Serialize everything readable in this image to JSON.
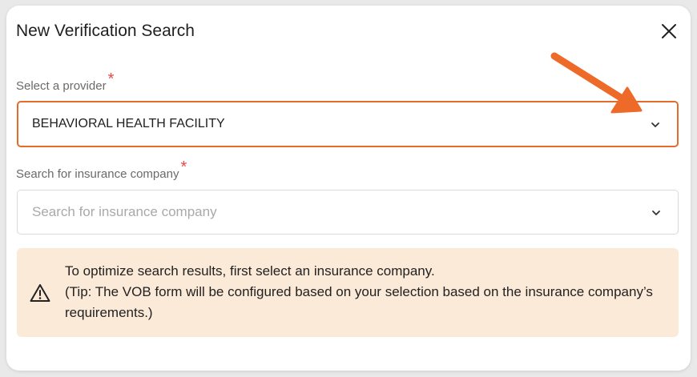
{
  "dialog": {
    "title": "New Verification Search",
    "close_icon": "close-icon"
  },
  "provider": {
    "label": "Select a provider",
    "required_marker": "*",
    "value": "BEHAVIORAL HEALTH FACILITY",
    "state": "focused",
    "icon": "chevron-down-icon"
  },
  "insurance": {
    "label": "Search for insurance company",
    "required_marker": "*",
    "placeholder": "Search for insurance company",
    "value": "",
    "icon": "chevron-down-icon"
  },
  "notice": {
    "icon": "warning-icon",
    "line1": "To optimize search results, first select an insurance company.",
    "line2": "(Tip: The VOB form will be configured based on your selection based on the insurance company’s requirements.)"
  },
  "annotation": {
    "icon": "arrow-pointer-icon",
    "color": "#ee6a28"
  },
  "colors": {
    "accent": "#e36b2c",
    "required": "#ef4444",
    "notice_bg": "#fbead8"
  }
}
